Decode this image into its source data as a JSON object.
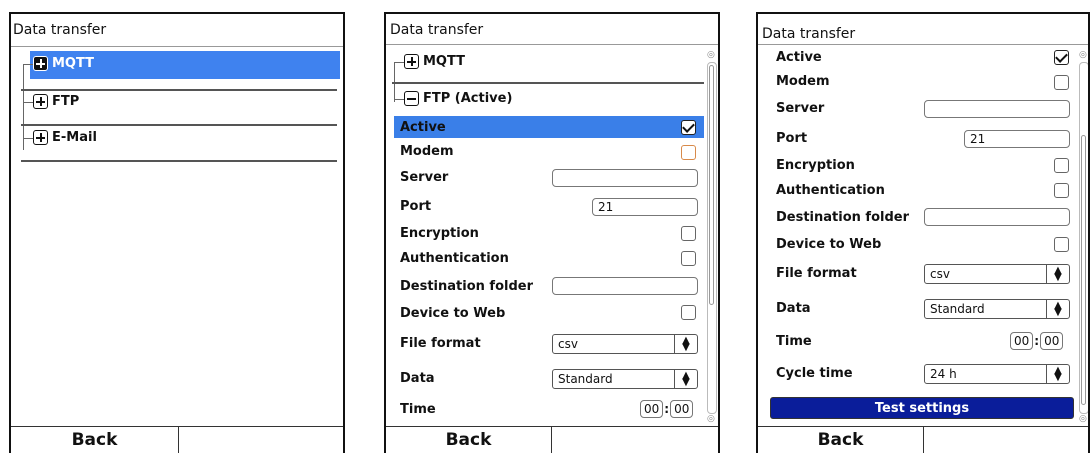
{
  "screen1": {
    "title": "Data transfer",
    "tree": [
      {
        "label": "MQTT",
        "selected": true
      },
      {
        "label": "FTP",
        "selected": false
      },
      {
        "label": "E-Mail",
        "selected": false
      }
    ],
    "footer": {
      "back": "Back"
    }
  },
  "screen2": {
    "title": "Data transfer",
    "group_mqtt": "MQTT",
    "group_ftp": "FTP (Active)",
    "params": {
      "active": "Active",
      "modem": "Modem",
      "server": "Server",
      "port": "Port",
      "port_value": "21",
      "encryption": "Encryption",
      "authentication": "Authentication",
      "destination_folder": "Destination folder",
      "device_to_web": "Device to Web",
      "file_format": "File format",
      "file_format_value": "csv",
      "data": "Data",
      "data_value": "Standard",
      "time": "Time",
      "time_hh": "00",
      "time_mm": "00"
    },
    "footer": {
      "back": "Back"
    }
  },
  "screen3": {
    "title": "Data transfer",
    "params": {
      "active": "Active",
      "modem": "Modem",
      "server": "Server",
      "port": "Port",
      "port_value": "21",
      "encryption": "Encryption",
      "authentication": "Authentication",
      "destination_folder": "Destination folder",
      "device_to_web": "Device to Web",
      "file_format": "File format",
      "file_format_value": "csv",
      "data": "Data",
      "data_value": "Standard",
      "time": "Time",
      "time_hh": "00",
      "time_mm": "00",
      "cycle_time": "Cycle time",
      "cycle_time_value": "24 h"
    },
    "test_button": "Test settings",
    "footer": {
      "back": "Back"
    }
  },
  "colors": {
    "selection": "#3f82ef",
    "highlight_row": "#3a7fe8",
    "test_button": "#0a1d9a"
  },
  "icons": [
    "plus-box-icon",
    "minus-box-icon",
    "checkbox-icon",
    "select-arrows-icon",
    "scroll-up-icon",
    "scroll-down-icon"
  ]
}
